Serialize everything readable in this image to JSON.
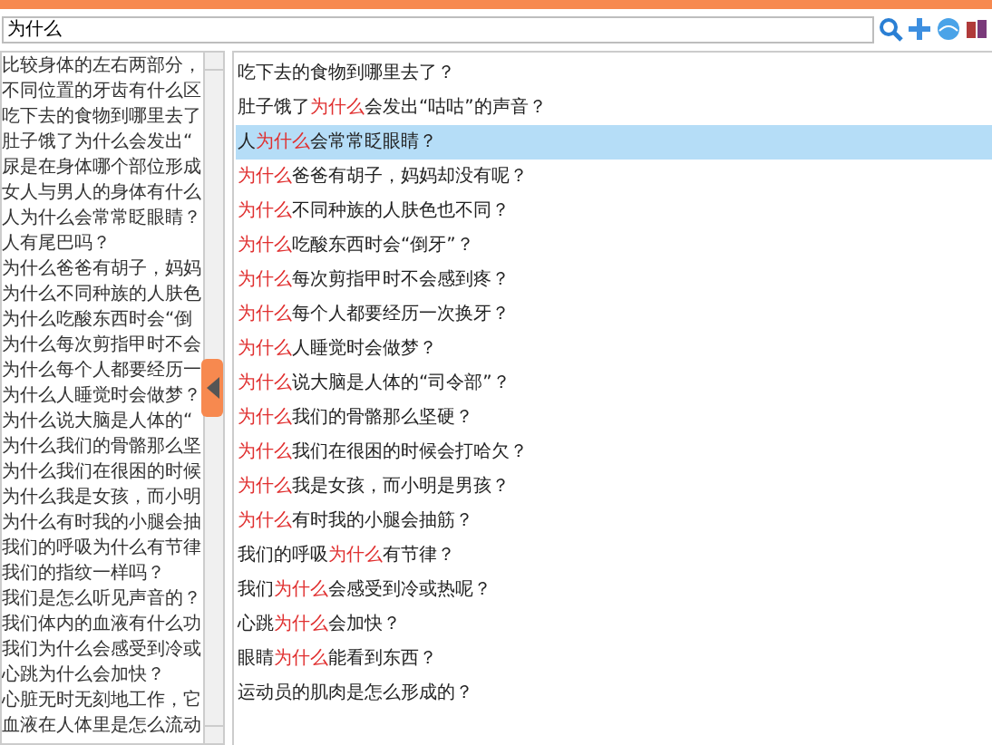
{
  "search": {
    "value": "为什么"
  },
  "left_list": [
    "比较身体的左右两部分，",
    "不同位置的牙齿有什么区",
    "吃下去的食物到哪里去了",
    "肚子饿了为什么会发出“",
    "尿是在身体哪个部位形成",
    "女人与男人的身体有什么",
    "人为什么会常常眨眼睛？",
    "人有尾巴吗？",
    "为什么爸爸有胡子，妈妈",
    "为什么不同种族的人肤色",
    "为什么吃酸东西时会“倒",
    "为什么每次剪指甲时不会",
    "为什么每个人都要经历一",
    "为什么人睡觉时会做梦？",
    "为什么说大脑是人体的“",
    "为什么我们的骨骼那么坚",
    "为什么我们在很困的时候",
    "为什么我是女孩，而小明",
    "为什么有时我的小腿会抽",
    "我们的呼吸为什么有节律",
    "我们的指纹一样吗？",
    "我们是怎么听见声音的？",
    "我们体内的血液有什么功",
    "我们为什么会感受到冷或",
    "心跳为什么会加快？",
    "心脏无时无刻地工作，它",
    "血液在人体里是怎么流动"
  ],
  "results": [
    {
      "before": "吃下去的食物到哪里去了？",
      "selected": false
    },
    {
      "before": "肚子饿了",
      "keyword": "为什么",
      "after": "会发出“咕咕”的声音？",
      "selected": false
    },
    {
      "before": "人",
      "keyword": "为什么",
      "after": "会常常眨眼睛？",
      "selected": true
    },
    {
      "keyword": "为什么",
      "after": "爸爸有胡子，妈妈却没有呢？",
      "selected": false
    },
    {
      "keyword": "为什么",
      "after": "不同种族的人肤色也不同？",
      "selected": false
    },
    {
      "keyword": "为什么",
      "after": "吃酸东西时会“倒牙”？",
      "selected": false
    },
    {
      "keyword": "为什么",
      "after": "每次剪指甲时不会感到疼？",
      "selected": false
    },
    {
      "keyword": "为什么",
      "after": "每个人都要经历一次换牙？",
      "selected": false
    },
    {
      "keyword": "为什么",
      "after": "人睡觉时会做梦？",
      "selected": false
    },
    {
      "keyword": "为什么",
      "after": "说大脑是人体的“司令部”？",
      "selected": false
    },
    {
      "keyword": "为什么",
      "after": "我们的骨骼那么坚硬？",
      "selected": false
    },
    {
      "keyword": "为什么",
      "after": "我们在很困的时候会打哈欠？",
      "selected": false
    },
    {
      "keyword": "为什么",
      "after": "我是女孩，而小明是男孩？",
      "selected": false
    },
    {
      "keyword": "为什么",
      "after": "有时我的小腿会抽筋？",
      "selected": false
    },
    {
      "before": "我们的呼吸",
      "keyword": "为什么",
      "after": "有节律？",
      "selected": false
    },
    {
      "before": "我们",
      "keyword": "为什么",
      "after": "会感受到冷或热呢？",
      "selected": false
    },
    {
      "before": "心跳",
      "keyword": "为什么",
      "after": "会加快？",
      "selected": false
    },
    {
      "before": "眼睛",
      "keyword": "为什么",
      "after": "能看到东西？",
      "selected": false
    },
    {
      "before": "运动员的肌肉是怎么形成的？",
      "selected": false
    }
  ]
}
